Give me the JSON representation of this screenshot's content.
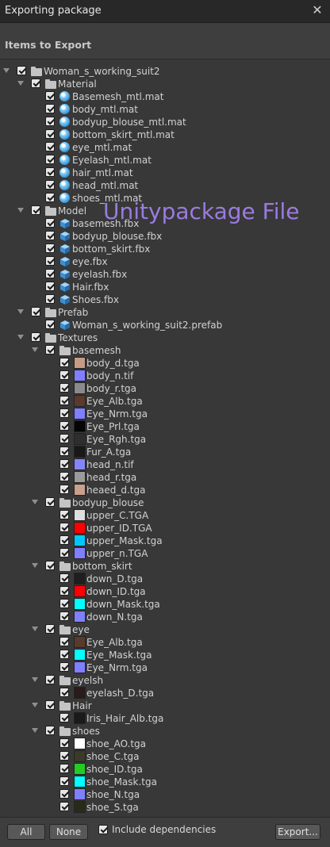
{
  "window": {
    "title": "Exporting package",
    "close_glyph": "✕"
  },
  "header": {
    "title": "Items to Export"
  },
  "watermark": "Unitypackage File",
  "tree": [
    {
      "d": 0,
      "t": "folder",
      "label": "Woman_s_working_suit2",
      "fold": true
    },
    {
      "d": 1,
      "t": "folder",
      "label": "Material",
      "fold": true
    },
    {
      "d": 2,
      "t": "mat",
      "label": "Basemesh_mtl.mat"
    },
    {
      "d": 2,
      "t": "mat",
      "label": "body_mtl.mat"
    },
    {
      "d": 2,
      "t": "mat",
      "label": "bodyup_blouse_mtl.mat"
    },
    {
      "d": 2,
      "t": "mat",
      "label": "bottom_skirt_mtl.mat"
    },
    {
      "d": 2,
      "t": "mat",
      "label": "eye_mtl.mat"
    },
    {
      "d": 2,
      "t": "mat",
      "label": "Eyelash_mtl.mat"
    },
    {
      "d": 2,
      "t": "mat",
      "label": "hair_mtl.mat"
    },
    {
      "d": 2,
      "t": "mat",
      "label": "head_mtl.mat"
    },
    {
      "d": 2,
      "t": "mat",
      "label": "shoes_mtl.mat"
    },
    {
      "d": 1,
      "t": "folder",
      "label": "Model",
      "fold": true
    },
    {
      "d": 2,
      "t": "mesh",
      "label": "basemesh.fbx"
    },
    {
      "d": 2,
      "t": "mesh",
      "label": "bodyup_blouse.fbx"
    },
    {
      "d": 2,
      "t": "mesh",
      "label": "bottom_skirt.fbx"
    },
    {
      "d": 2,
      "t": "mesh",
      "label": "eye.fbx"
    },
    {
      "d": 2,
      "t": "mesh",
      "label": "eyelash.fbx"
    },
    {
      "d": 2,
      "t": "mesh",
      "label": "Hair.fbx"
    },
    {
      "d": 2,
      "t": "mesh",
      "label": "Shoes.fbx"
    },
    {
      "d": 1,
      "t": "folder",
      "label": "Prefab",
      "fold": true
    },
    {
      "d": 2,
      "t": "prefab",
      "label": "Woman_s_working_suit2.prefab"
    },
    {
      "d": 1,
      "t": "folder",
      "label": "Textures",
      "fold": true
    },
    {
      "d": 2,
      "t": "folder",
      "label": "basemesh",
      "fold": true
    },
    {
      "d": 3,
      "t": "tex",
      "label": "body_d.tga",
      "color": "#c79a86"
    },
    {
      "d": 3,
      "t": "tex",
      "label": "body_n.tif",
      "color": "#8080ff"
    },
    {
      "d": 3,
      "t": "tex",
      "label": "body_r.tga",
      "color": "#8a8a8a"
    },
    {
      "d": 3,
      "t": "tex",
      "label": "Eye_Alb.tga",
      "color": "#5a3a2c"
    },
    {
      "d": 3,
      "t": "tex",
      "label": "Eye_Nrm.tga",
      "color": "#7f7fff"
    },
    {
      "d": 3,
      "t": "tex",
      "label": "Eye_Prl.tga",
      "color": "#050505"
    },
    {
      "d": 3,
      "t": "tex",
      "label": "Eye_Rgh.tga",
      "color": "#2e2e2e"
    },
    {
      "d": 3,
      "t": "tex",
      "label": "Fur_A.tga",
      "color": "#181818"
    },
    {
      "d": 3,
      "t": "tex",
      "label": "head_n.tif",
      "color": "#8585fa"
    },
    {
      "d": 3,
      "t": "tex",
      "label": "head_r.tga",
      "color": "#9a9a9a"
    },
    {
      "d": 3,
      "t": "tex",
      "label": "heaed_d.tga",
      "color": "#c8a08c"
    },
    {
      "d": 2,
      "t": "folder",
      "label": "bodyup_blouse",
      "fold": true
    },
    {
      "d": 3,
      "t": "tex",
      "label": "upper_C.TGA",
      "color": "#dedede"
    },
    {
      "d": 3,
      "t": "tex",
      "label": "upper_ID.TGA",
      "color": "#ff0000"
    },
    {
      "d": 3,
      "t": "tex",
      "label": "upper_Mask.tga",
      "color": "#00c8ff"
    },
    {
      "d": 3,
      "t": "tex",
      "label": "upper_n.TGA",
      "color": "#8080ff"
    },
    {
      "d": 2,
      "t": "folder",
      "label": "bottom_skirt",
      "fold": true
    },
    {
      "d": 3,
      "t": "tex",
      "label": "down_D.tga",
      "color": "#1e1e1e"
    },
    {
      "d": 3,
      "t": "tex",
      "label": "down_ID.tga",
      "color": "#ff0000"
    },
    {
      "d": 3,
      "t": "tex",
      "label": "down_Mask.tga",
      "color": "#00ffff"
    },
    {
      "d": 3,
      "t": "tex",
      "label": "down_N.tga",
      "color": "#8080ff"
    },
    {
      "d": 2,
      "t": "folder",
      "label": "eye",
      "fold": true
    },
    {
      "d": 3,
      "t": "tex",
      "label": "Eye_Alb.tga",
      "color": "#5a3a2c"
    },
    {
      "d": 3,
      "t": "tex",
      "label": "Eye_Mask.tga",
      "color": "#00ffff"
    },
    {
      "d": 3,
      "t": "tex",
      "label": "Eye_Nrm.tga",
      "color": "#7f7fff"
    },
    {
      "d": 2,
      "t": "folder",
      "label": "eyelsh",
      "fold": true
    },
    {
      "d": 3,
      "t": "tex",
      "label": "eyelash_D.tga",
      "color": "#2a1a1a"
    },
    {
      "d": 2,
      "t": "folder",
      "label": "Hair",
      "fold": true
    },
    {
      "d": 3,
      "t": "tex",
      "label": "Iris_Hair_Alb.tga",
      "color": "#1a1a1a"
    },
    {
      "d": 2,
      "t": "folder",
      "label": "shoes",
      "fold": true
    },
    {
      "d": 3,
      "t": "tex",
      "label": "shoe_AO.tga",
      "color": "#ffffff"
    },
    {
      "d": 3,
      "t": "tex",
      "label": "shoe_C.tga",
      "color": "#3a3a2a"
    },
    {
      "d": 3,
      "t": "tex",
      "label": "shoe_ID.tga",
      "color": "#22cc22"
    },
    {
      "d": 3,
      "t": "tex",
      "label": "shoe_Mask.tga",
      "color": "#00ffff"
    },
    {
      "d": 3,
      "t": "tex",
      "label": "shoe_N.tga",
      "color": "#8080ff"
    },
    {
      "d": 3,
      "t": "tex",
      "label": "shoe_S.tga",
      "color": "#2a2a1a"
    }
  ],
  "footer": {
    "all_label": "All",
    "none_label": "None",
    "include_dependencies_label": "Include dependencies",
    "export_label": "Export..."
  }
}
